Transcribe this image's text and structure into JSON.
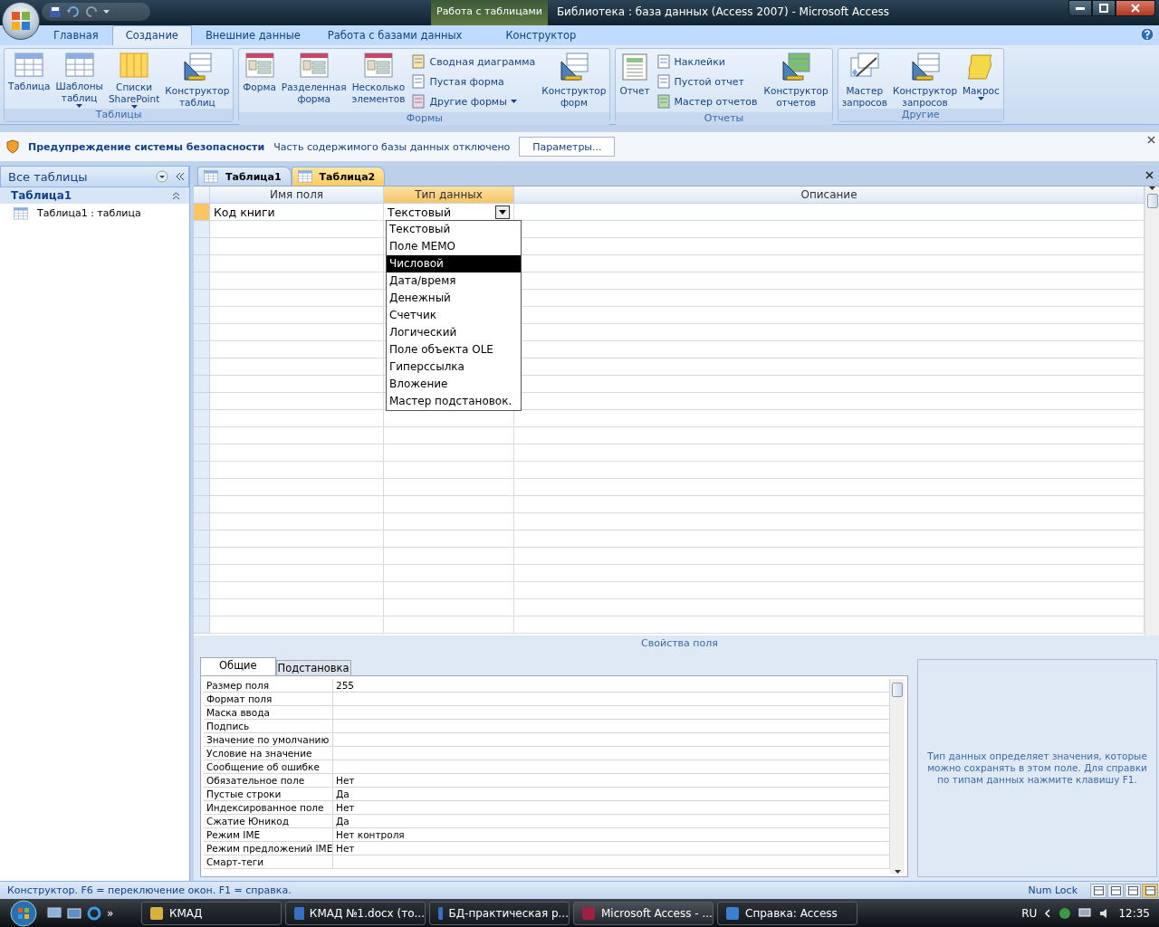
{
  "window": {
    "title": "Библиотека : база данных (Access 2007) - Microsoft Access",
    "context_tab": "Работа с таблицами"
  },
  "ribbon": {
    "tabs": [
      {
        "label": "Главная",
        "selected": false
      },
      {
        "label": "Создание",
        "selected": true
      },
      {
        "label": "Внешние данные",
        "selected": false
      },
      {
        "label": "Работа с базами данных",
        "selected": false
      },
      {
        "label": "Конструктор",
        "selected": false
      }
    ],
    "groups": [
      {
        "label": "Таблицы",
        "items": [
          {
            "kind": "large",
            "label": "Таблица",
            "dropdown": false
          },
          {
            "kind": "large",
            "label": "Шаблоны\nтаблиц",
            "dropdown": true
          },
          {
            "kind": "large",
            "label": "Списки\nSharePoint",
            "dropdown": true
          },
          {
            "kind": "large",
            "label": "Конструктор\nтаблиц",
            "dropdown": false
          }
        ]
      },
      {
        "label": "Формы",
        "items": [
          {
            "kind": "large",
            "label": "Форма",
            "dropdown": false
          },
          {
            "kind": "large",
            "label": "Разделенная\nформа",
            "dropdown": false
          },
          {
            "kind": "large",
            "label": "Несколько\nэлементов",
            "dropdown": false
          },
          {
            "kind": "small",
            "label": "Сводная диаграмма",
            "dropdown": false
          },
          {
            "kind": "small",
            "label": "Пустая форма",
            "dropdown": false
          },
          {
            "kind": "small",
            "label": "Другие формы",
            "dropdown": true
          },
          {
            "kind": "large",
            "label": "Конструктор\nформ",
            "dropdown": false
          }
        ]
      },
      {
        "label": "Отчеты",
        "items": [
          {
            "kind": "large",
            "label": "Отчет",
            "dropdown": false
          },
          {
            "kind": "small",
            "label": "Наклейки",
            "dropdown": false
          },
          {
            "kind": "small",
            "label": "Пустой отчет",
            "dropdown": false
          },
          {
            "kind": "small",
            "label": "Мастер отчетов",
            "dropdown": false
          },
          {
            "kind": "large",
            "label": "Конструктор\nотчетов",
            "dropdown": false
          }
        ]
      },
      {
        "label": "Другие",
        "items": [
          {
            "kind": "large",
            "label": "Мастер\nзапросов",
            "dropdown": false
          },
          {
            "kind": "large",
            "label": "Конструктор\nзапросов",
            "dropdown": false
          },
          {
            "kind": "large",
            "label": "Макрос",
            "dropdown": true
          }
        ]
      }
    ]
  },
  "security_bar": {
    "title": "Предупреждение системы безопасности",
    "message": "Часть содержимого базы данных отключено",
    "button": "Параметры..."
  },
  "nav_pane": {
    "header": "Все таблицы",
    "group": "Таблица1",
    "items": [
      "Таблица1 : таблица"
    ]
  },
  "doc_tabs": [
    {
      "label": "Таблица1",
      "selected": false
    },
    {
      "label": "Таблица2",
      "selected": true
    }
  ],
  "design_grid": {
    "columns": [
      {
        "label": "Имя поля",
        "selected": false
      },
      {
        "label": "Тип данных",
        "selected": true
      },
      {
        "label": "Описание",
        "selected": false
      }
    ],
    "rows": [
      {
        "name": "Код книги",
        "type": "Текстовый",
        "selected": true
      }
    ]
  },
  "type_dropdown": {
    "options": [
      {
        "label": "Текстовый",
        "selected": false
      },
      {
        "label": "Поле MEMO",
        "selected": false
      },
      {
        "label": "Числовой",
        "selected": true
      },
      {
        "label": "Дата/время",
        "selected": false
      },
      {
        "label": "Денежный",
        "selected": false
      },
      {
        "label": "Счетчик",
        "selected": false
      },
      {
        "label": "Логический",
        "selected": false
      },
      {
        "label": "Поле объекта OLE",
        "selected": false
      },
      {
        "label": "Гиперссылка",
        "selected": false
      },
      {
        "label": "Вложение",
        "selected": false
      },
      {
        "label": "Мастер подстановок.",
        "selected": false
      }
    ]
  },
  "field_properties": {
    "title": "Свойства поля",
    "tabs": [
      {
        "label": "Общие",
        "selected": true
      },
      {
        "label": "Подстановка",
        "selected": false
      }
    ],
    "properties": [
      {
        "label": "Размер поля",
        "value": "255"
      },
      {
        "label": "Формат поля"
      },
      {
        "label": "Маска ввода"
      },
      {
        "label": "Подпись"
      },
      {
        "label": "Значение по умолчанию"
      },
      {
        "label": "Условие на значение"
      },
      {
        "label": "Сообщение об ошибке"
      },
      {
        "label": "Обязательное поле",
        "value": "Нет"
      },
      {
        "label": "Пустые строки",
        "value": "Да"
      },
      {
        "label": "Индексированное поле",
        "value": "Нет"
      },
      {
        "label": "Сжатие Юникод",
        "value": "Да"
      },
      {
        "label": "Режим IME",
        "value": "Нет контроля"
      },
      {
        "label": "Режим предложений IME",
        "value": "Нет"
      },
      {
        "label": "Смарт-теги"
      }
    ],
    "help": "Тип данных определяет значения, которые можно сохранять в этом поле.  Для справки по типам данных нажмите клавишу F1."
  },
  "status_bar": {
    "text": "Конструктор.  F6 = переключение окон.  F1 = справка.",
    "indicator": "Num Lock"
  },
  "taskbar": {
    "quick_launch_more": "»",
    "items": [
      {
        "label": "КМАД",
        "selected": false
      },
      {
        "label": "КМАД №1.docx (то...",
        "selected": false
      },
      {
        "label": "БД-практическая р...",
        "selected": false
      },
      {
        "label": "Microsoft Access - ...",
        "selected": true
      },
      {
        "label": "Справка: Access",
        "selected": false
      }
    ],
    "language": "RU",
    "clock": "12:35"
  }
}
